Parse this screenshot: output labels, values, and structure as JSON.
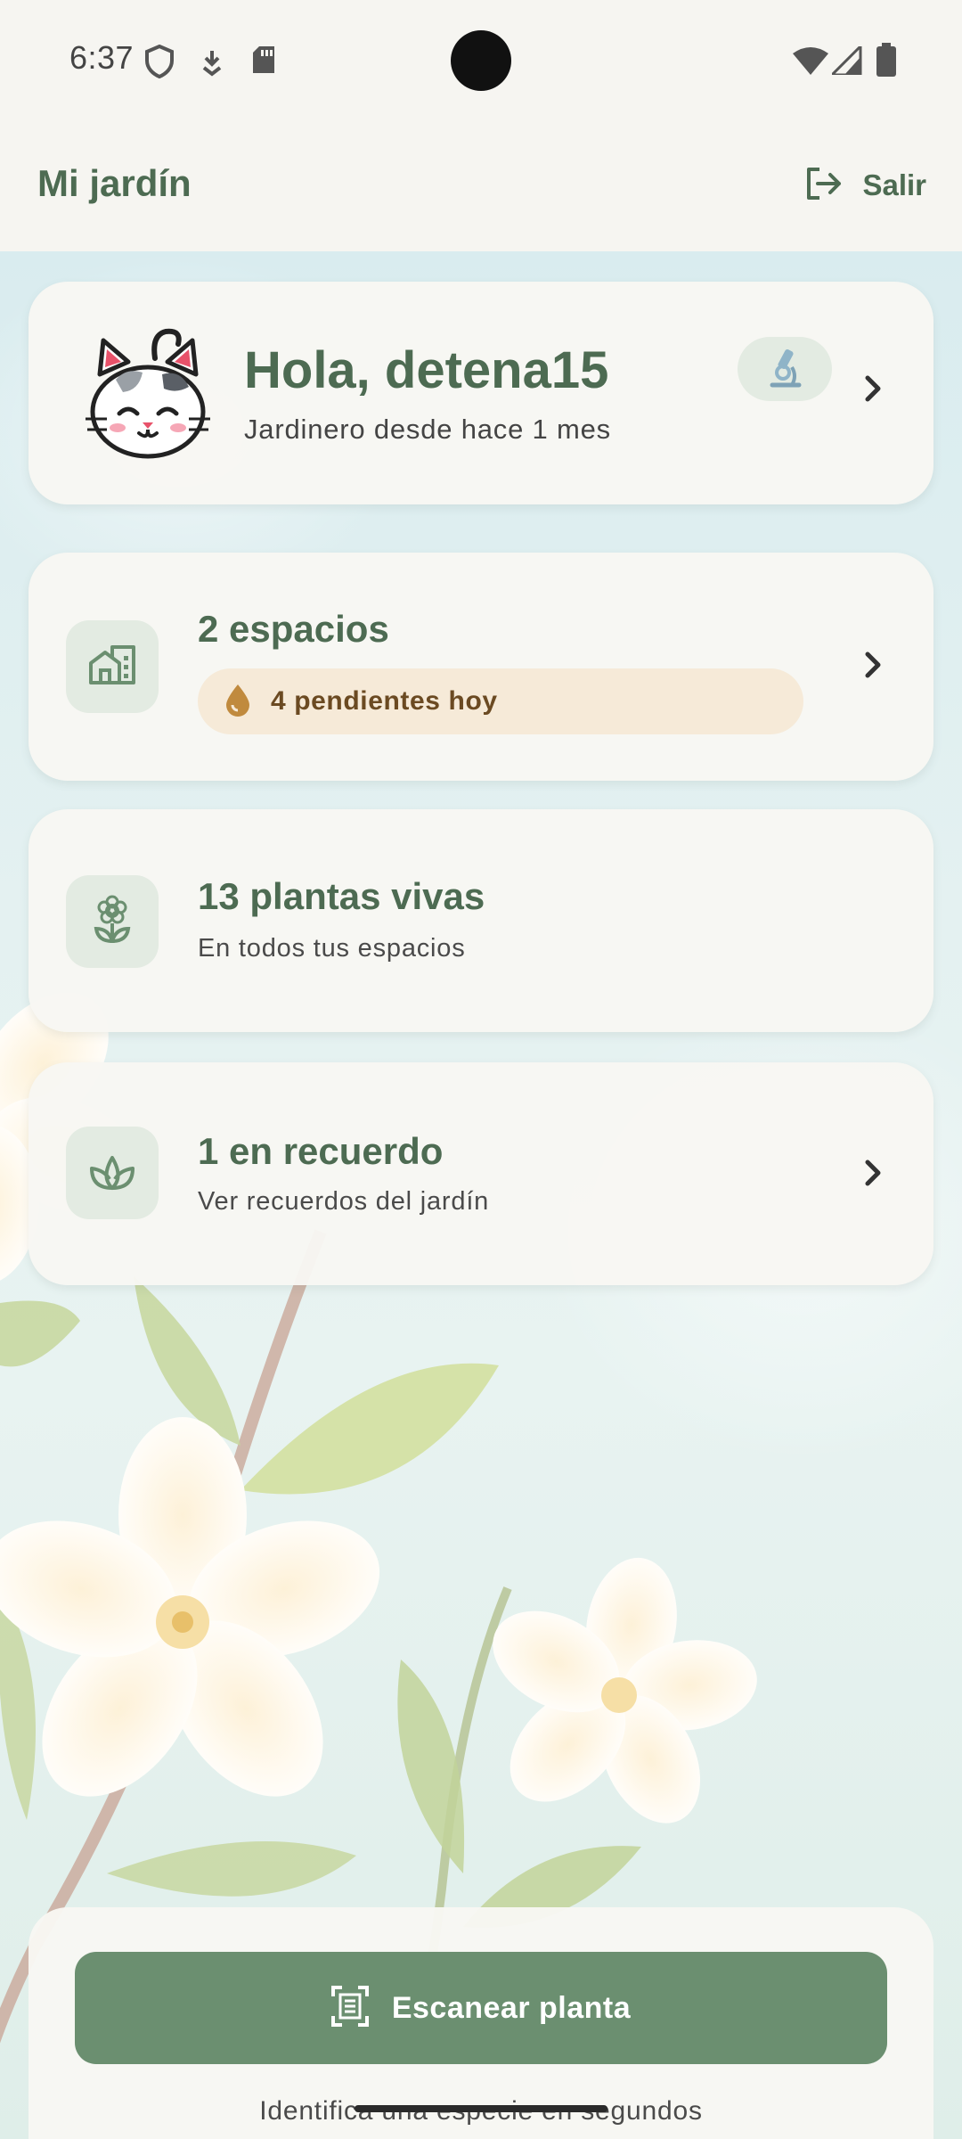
{
  "status_bar": {
    "time": "6:37",
    "icons": [
      "shield-icon",
      "download-icon",
      "sd-card-icon",
      "wifi-icon",
      "signal-icon",
      "battery-icon"
    ]
  },
  "app_bar": {
    "title": "Mi jardín",
    "logout_label": "Salir",
    "logout_icon": "logout-icon"
  },
  "profile": {
    "greeting": "Hola, detena15",
    "since": "Jardinero desde hace 1 mes",
    "avatar": "cat-avatar",
    "badge_icon": "microscope-icon"
  },
  "spaces": {
    "title": "2 espacios",
    "pending": "4 pendientes hoy",
    "icon": "buildings-icon",
    "pending_icon": "water-drop-icon"
  },
  "plants": {
    "title": "13 plantas vivas",
    "subtitle": "En todos tus espacios",
    "icon": "flower-icon"
  },
  "memory": {
    "title": "1 en recuerdo",
    "subtitle": "Ver recuerdos del jardín",
    "icon": "sprout-icon"
  },
  "scan": {
    "button_label": "Escanear planta",
    "caption": "Identifica una especie en segundos",
    "icon": "scan-icon"
  },
  "colors": {
    "primary_green": "#4d6b52",
    "button_green": "#6b8f70",
    "pending_bg": "#f6ead8",
    "pending_text": "#6b4a22"
  }
}
